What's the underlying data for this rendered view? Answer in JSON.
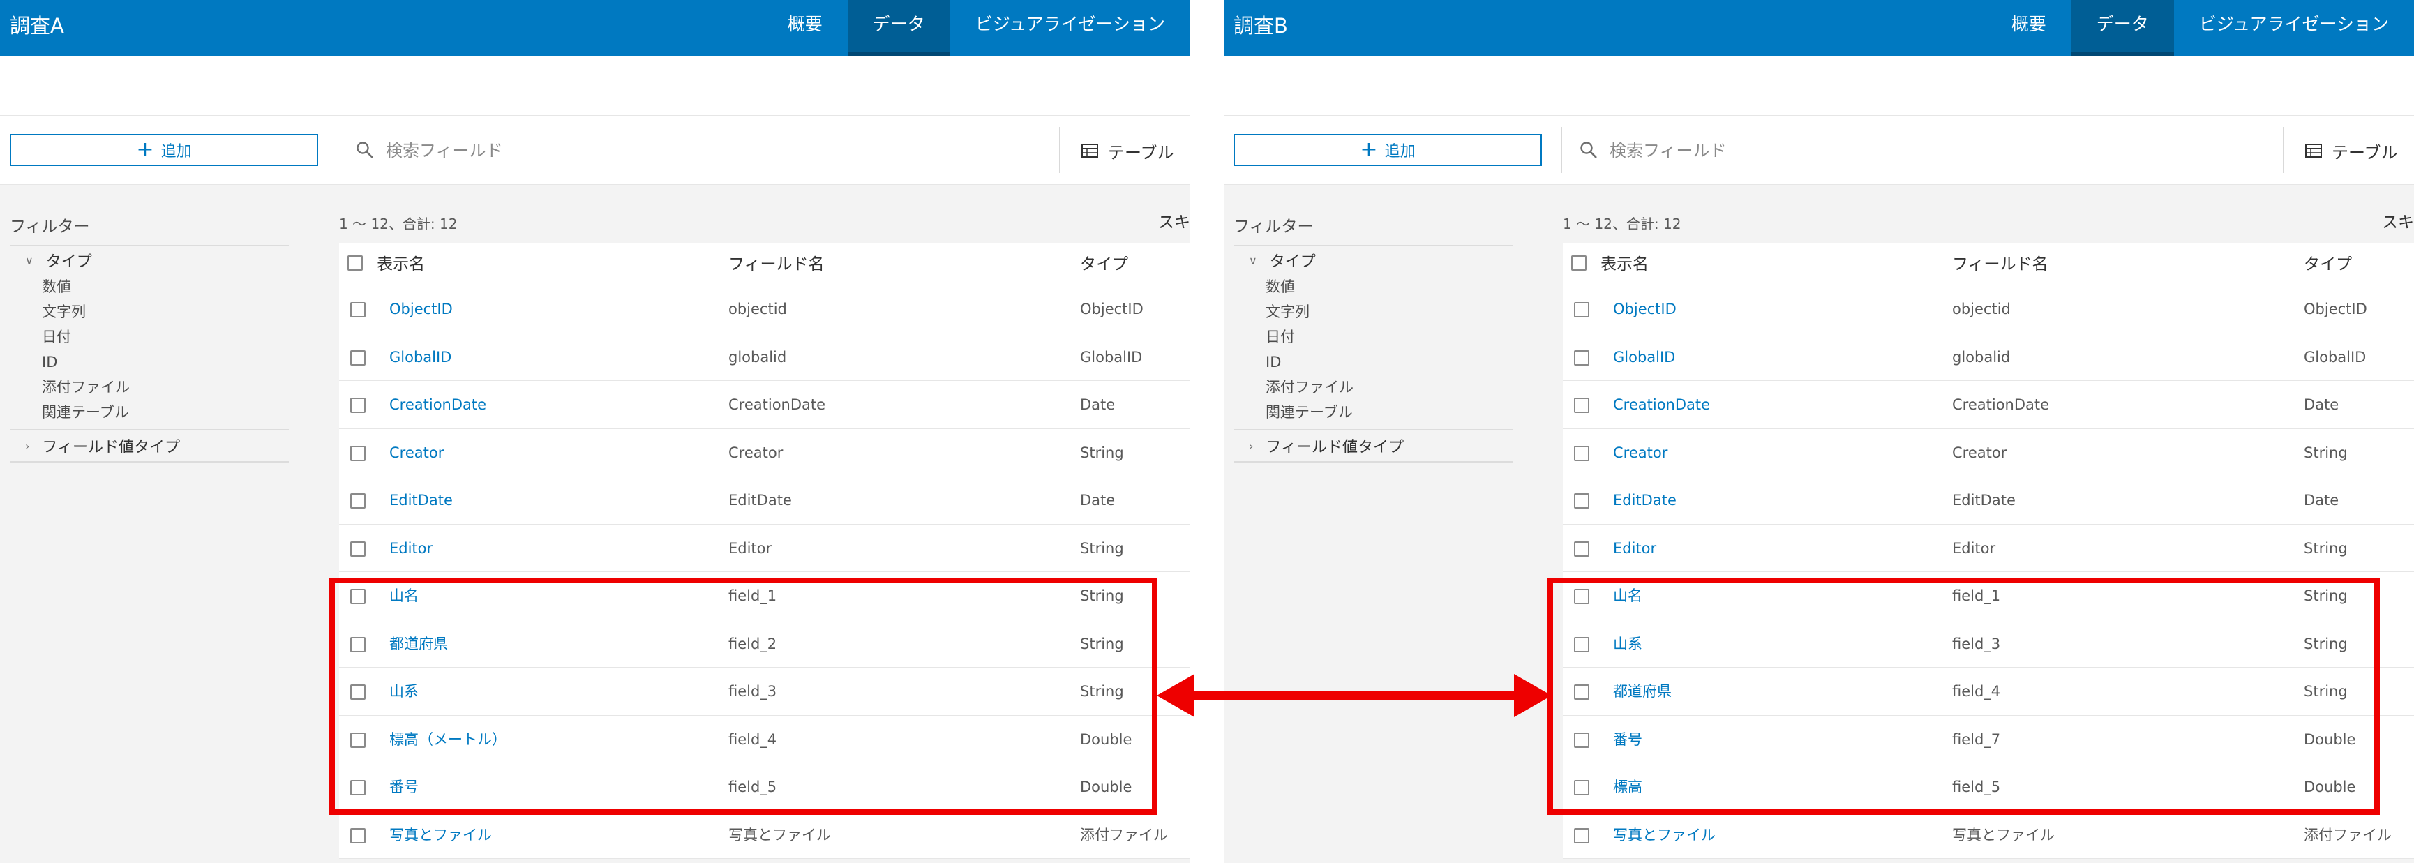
{
  "panels": [
    {
      "title": "調査A",
      "nav": [
        "概要",
        "データ",
        "ビジュアライゼーション"
      ],
      "add_label": "追加",
      "search_placeholder": "検索フィールド",
      "table_label": "テーブル",
      "filter_title": "フィルター",
      "filter_group_type": "タイプ",
      "filter_items": [
        "数値",
        "文字列",
        "日付",
        "ID",
        "添付ファイル",
        "関連テーブル"
      ],
      "filter_group_value": "フィールド値タイプ",
      "count_text": "1 ～ 12、合計: 12",
      "right_text": "スキ",
      "columns": [
        "表示名",
        "フィールド名",
        "タイプ"
      ],
      "rows": [
        [
          "ObjectID",
          "objectid",
          "ObjectID"
        ],
        [
          "GlobalID",
          "globalid",
          "GlobalID"
        ],
        [
          "CreationDate",
          "CreationDate",
          "Date"
        ],
        [
          "Creator",
          "Creator",
          "String"
        ],
        [
          "EditDate",
          "EditDate",
          "Date"
        ],
        [
          "Editor",
          "Editor",
          "String"
        ],
        [
          "山名",
          "field_1",
          "String"
        ],
        [
          "都道府県",
          "field_2",
          "String"
        ],
        [
          "山系",
          "field_3",
          "String"
        ],
        [
          "標高（メートル）",
          "field_4",
          "Double"
        ],
        [
          "番号",
          "field_5",
          "Double"
        ],
        [
          "写真とファイル",
          "写真とファイル",
          "添付ファイル"
        ]
      ]
    },
    {
      "title": "調査B",
      "nav": [
        "概要",
        "データ",
        "ビジュアライゼーション"
      ],
      "add_label": "追加",
      "search_placeholder": "検索フィールド",
      "table_label": "テーブル",
      "filter_title": "フィルター",
      "filter_group_type": "タイプ",
      "filter_items": [
        "数値",
        "文字列",
        "日付",
        "ID",
        "添付ファイル",
        "関連テーブル"
      ],
      "filter_group_value": "フィールド値タイプ",
      "count_text": "1 ～ 12、合計: 12",
      "right_text": "スキ",
      "columns": [
        "表示名",
        "フィールド名",
        "タイプ"
      ],
      "rows": [
        [
          "ObjectID",
          "objectid",
          "ObjectID"
        ],
        [
          "GlobalID",
          "globalid",
          "GlobalID"
        ],
        [
          "CreationDate",
          "CreationDate",
          "Date"
        ],
        [
          "Creator",
          "Creator",
          "String"
        ],
        [
          "EditDate",
          "EditDate",
          "Date"
        ],
        [
          "Editor",
          "Editor",
          "String"
        ],
        [
          "山名",
          "field_1",
          "String"
        ],
        [
          "山系",
          "field_3",
          "String"
        ],
        [
          "都道府県",
          "field_4",
          "String"
        ],
        [
          "番号",
          "field_7",
          "Double"
        ],
        [
          "標高",
          "field_5",
          "Double"
        ],
        [
          "写真とファイル",
          "写真とファイル",
          "添付ファイル"
        ]
      ]
    }
  ],
  "colors": {
    "header": "#0079c1",
    "nav_active": "#005e95",
    "link": "#0079c1",
    "highlight": "#ee0000"
  }
}
